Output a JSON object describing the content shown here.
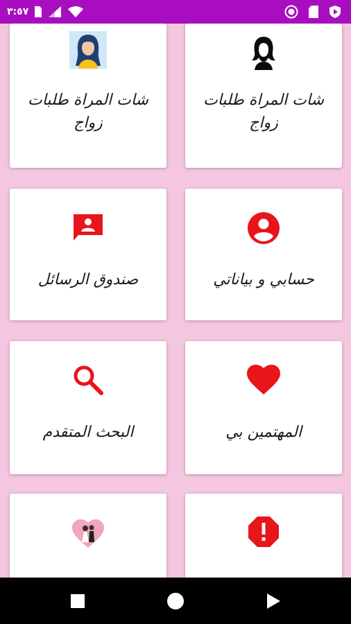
{
  "status_bar": {
    "time": "٣:٥٧",
    "left_icons": [
      "sim-card-icon",
      "signal-icon",
      "wifi-icon"
    ],
    "right_icons": [
      "record-icon",
      "sd-card-icon",
      "shield-play-icon"
    ],
    "color": "#a80ec0"
  },
  "cards": [
    {
      "label": "شات المراة طلبات زواج",
      "icon": "woman-silhouette-icon"
    },
    {
      "label": "شات المراة طلبات زواج",
      "icon": "woman-portrait-icon"
    },
    {
      "label": "حسابي و بياناتي",
      "icon": "account-circle-icon"
    },
    {
      "label": "صندوق الرسائل",
      "icon": "message-box-icon"
    },
    {
      "label": "المهتمين بي",
      "icon": "heart-icon"
    },
    {
      "label": "البحث المتقدم",
      "icon": "search-icon"
    },
    {
      "label": "",
      "icon": "alert-octagon-icon"
    },
    {
      "label": "",
      "icon": "couple-heart-icon"
    }
  ],
  "nav_bar": {
    "buttons": [
      "recents-square-icon",
      "home-circle-icon",
      "back-triangle-icon"
    ]
  },
  "colors": {
    "background": "#f5c6df",
    "accent_red": "#e8151b",
    "status_bar": "#a80ec0"
  }
}
